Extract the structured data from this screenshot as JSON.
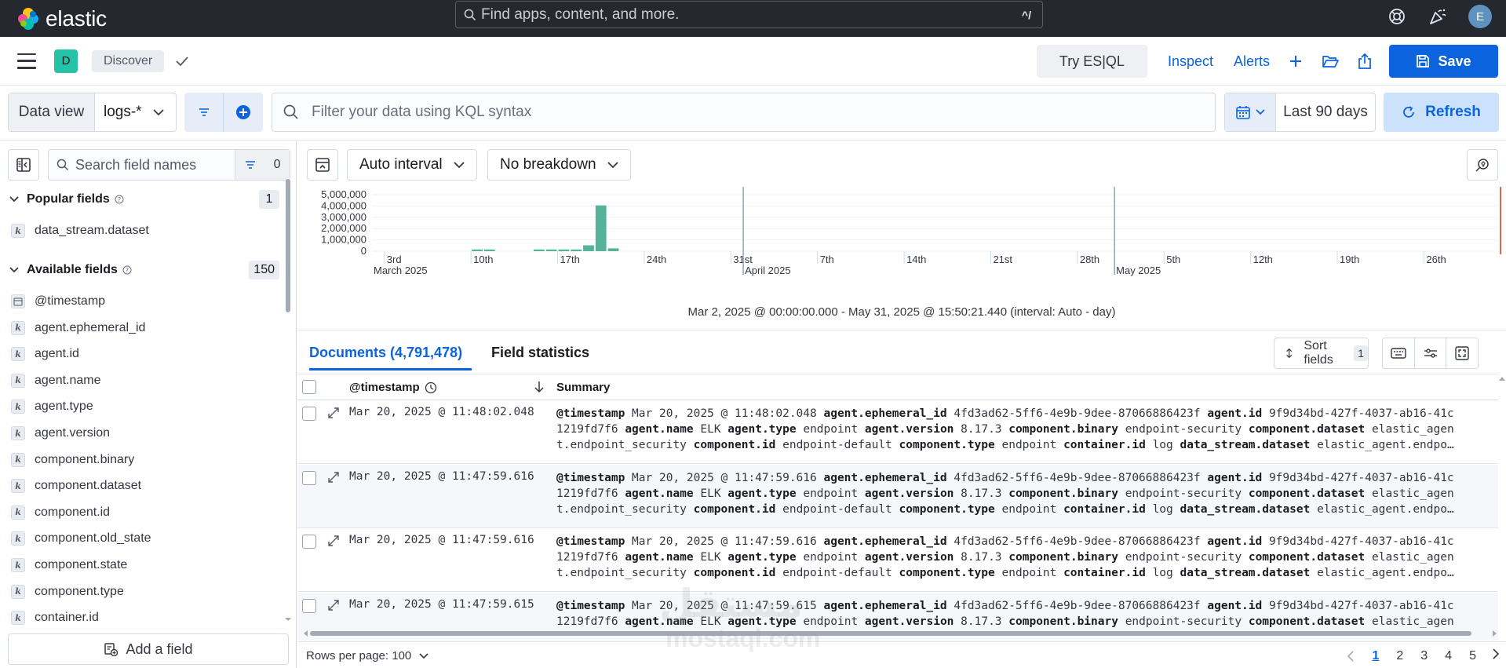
{
  "app": {
    "name": "elastic",
    "space_initial": "D",
    "user_initial": "E"
  },
  "search": {
    "placeholder": "Find apps, content, and more.",
    "shortcut": "^/"
  },
  "breadcrumb": {
    "current": "Discover"
  },
  "header": {
    "try_esql": "Try ES|QL",
    "inspect": "Inspect",
    "alerts": "Alerts",
    "save": "Save"
  },
  "query": {
    "data_view_label": "Data view",
    "data_view_value": "logs-*",
    "kql_placeholder": "Filter your data using KQL syntax",
    "date_range": "Last 90 days",
    "refresh": "Refresh"
  },
  "sidebar": {
    "search_placeholder": "Search field names",
    "filter_count": "0",
    "popular_title": "Popular fields",
    "popular_count": "1",
    "popular_fields": [
      {
        "name": "data_stream.dataset",
        "type": "k"
      }
    ],
    "available_title": "Available fields",
    "available_count": "150",
    "available_fields": [
      {
        "name": "@timestamp",
        "type": "date"
      },
      {
        "name": "agent.ephemeral_id",
        "type": "k"
      },
      {
        "name": "agent.id",
        "type": "k"
      },
      {
        "name": "agent.name",
        "type": "k"
      },
      {
        "name": "agent.type",
        "type": "k"
      },
      {
        "name": "agent.version",
        "type": "k"
      },
      {
        "name": "component.binary",
        "type": "k"
      },
      {
        "name": "component.dataset",
        "type": "k"
      },
      {
        "name": "component.id",
        "type": "k"
      },
      {
        "name": "component.old_state",
        "type": "k"
      },
      {
        "name": "component.state",
        "type": "k"
      },
      {
        "name": "component.type",
        "type": "k"
      },
      {
        "name": "container.id",
        "type": "k"
      }
    ],
    "add_field": "Add a field"
  },
  "toolbar": {
    "interval": "Auto interval",
    "breakdown": "No breakdown"
  },
  "chart_data": {
    "type": "bar",
    "y_ticks": [
      "5,000,000",
      "4,000,000",
      "3,000,000",
      "2,000,000",
      "1,000,000",
      "0"
    ],
    "ylim": [
      0,
      5000000
    ],
    "x_ticks": [
      "3rd",
      "10th",
      "17th",
      "24th",
      "31st",
      "7th",
      "14th",
      "21st",
      "28th",
      "5th",
      "12th",
      "19th",
      "26th"
    ],
    "month_labels": [
      "March 2025",
      "April 2025",
      "May 2025"
    ],
    "x_start": "2025-03-02",
    "x_end": "2025-05-31",
    "bars": [
      {
        "date": "2025-03-10",
        "value": 150000
      },
      {
        "date": "2025-03-11",
        "value": 150000
      },
      {
        "date": "2025-03-15",
        "value": 150000
      },
      {
        "date": "2025-03-16",
        "value": 150000
      },
      {
        "date": "2025-03-17",
        "value": 150000
      },
      {
        "date": "2025-03-18",
        "value": 150000
      },
      {
        "date": "2025-03-19",
        "value": 520000
      },
      {
        "date": "2025-03-20",
        "value": 4050000
      },
      {
        "date": "2025-03-21",
        "value": 250000
      }
    ],
    "color": "#54b399",
    "range_text": "Mar 2, 2025 @ 00:00:00.000 - May 31, 2025 @ 15:50:21.440 (interval: Auto - day)"
  },
  "tabs": {
    "documents": "Documents (4,791,478)",
    "field_statistics": "Field statistics"
  },
  "grid": {
    "sort_fields": "Sort fields",
    "sort_count": "1",
    "col_timestamp": "@timestamp",
    "col_summary": "Summary",
    "rows": [
      {
        "timestamp": "Mar 20, 2025 @ 11:48:02.048",
        "line1": [
          [
            "@timestamp",
            "Mar 20, 2025 @ 11:48:02.048"
          ],
          [
            "agent.ephemeral_id",
            "4fd3ad62-5ff6-4e9b-9dee-87066886423f"
          ],
          [
            "agent.id",
            "9f9d34bd-427f-4037-ab16-41c"
          ]
        ],
        "line2": [
          [
            "",
            "1219fd7f6"
          ],
          [
            "agent.name",
            "ELK"
          ],
          [
            "agent.type",
            "endpoint"
          ],
          [
            "agent.version",
            "8.17.3"
          ],
          [
            "component.binary",
            "endpoint-security"
          ],
          [
            "component.dataset",
            "elastic_agen"
          ]
        ],
        "line3": [
          [
            "",
            "t.endpoint_security"
          ],
          [
            "component.id",
            "endpoint-default"
          ],
          [
            "component.type",
            "endpoint"
          ],
          [
            "container.id",
            "log"
          ],
          [
            "data_stream.dataset",
            "elastic_agent.endpo…"
          ]
        ]
      },
      {
        "timestamp": "Mar 20, 2025 @ 11:47:59.616",
        "line1": [
          [
            "@timestamp",
            "Mar 20, 2025 @ 11:47:59.616"
          ],
          [
            "agent.ephemeral_id",
            "4fd3ad62-5ff6-4e9b-9dee-87066886423f"
          ],
          [
            "agent.id",
            "9f9d34bd-427f-4037-ab16-41c"
          ]
        ],
        "line2": [
          [
            "",
            "1219fd7f6"
          ],
          [
            "agent.name",
            "ELK"
          ],
          [
            "agent.type",
            "endpoint"
          ],
          [
            "agent.version",
            "8.17.3"
          ],
          [
            "component.binary",
            "endpoint-security"
          ],
          [
            "component.dataset",
            "elastic_agen"
          ]
        ],
        "line3": [
          [
            "",
            "t.endpoint_security"
          ],
          [
            "component.id",
            "endpoint-default"
          ],
          [
            "component.type",
            "endpoint"
          ],
          [
            "container.id",
            "log"
          ],
          [
            "data_stream.dataset",
            "elastic_agent.endpo…"
          ]
        ]
      },
      {
        "timestamp": "Mar 20, 2025 @ 11:47:59.616",
        "line1": [
          [
            "@timestamp",
            "Mar 20, 2025 @ 11:47:59.616"
          ],
          [
            "agent.ephemeral_id",
            "4fd3ad62-5ff6-4e9b-9dee-87066886423f"
          ],
          [
            "agent.id",
            "9f9d34bd-427f-4037-ab16-41c"
          ]
        ],
        "line2": [
          [
            "",
            "1219fd7f6"
          ],
          [
            "agent.name",
            "ELK"
          ],
          [
            "agent.type",
            "endpoint"
          ],
          [
            "agent.version",
            "8.17.3"
          ],
          [
            "component.binary",
            "endpoint-security"
          ],
          [
            "component.dataset",
            "elastic_agen"
          ]
        ],
        "line3": [
          [
            "",
            "t.endpoint_security"
          ],
          [
            "component.id",
            "endpoint-default"
          ],
          [
            "component.type",
            "endpoint"
          ],
          [
            "container.id",
            "log"
          ],
          [
            "data_stream.dataset",
            "elastic_agent.endpo…"
          ]
        ]
      },
      {
        "timestamp": "Mar 20, 2025 @ 11:47:59.615",
        "line1": [
          [
            "@timestamp",
            "Mar 20, 2025 @ 11:47:59.615"
          ],
          [
            "agent.ephemeral_id",
            "4fd3ad62-5ff6-4e9b-9dee-87066886423f"
          ],
          [
            "agent.id",
            "9f9d34bd-427f-4037-ab16-41c"
          ]
        ],
        "line2": [
          [
            "",
            "1219fd7f6"
          ],
          [
            "agent.name",
            "ELK"
          ],
          [
            "agent.type",
            "endpoint"
          ],
          [
            "agent.version",
            "8.17.3"
          ],
          [
            "component.binary",
            "endpoint-security"
          ],
          [
            "component.dataset",
            "elastic_agen"
          ]
        ],
        "line3": []
      }
    ]
  },
  "footer": {
    "rows_per_page": "Rows per page: 100",
    "pages": [
      "1",
      "2",
      "3",
      "4",
      "5"
    ],
    "current_page": "1"
  },
  "watermark": {
    "line1": "مستقل",
    "line2": "mostaql.com"
  },
  "colors": {
    "accent": "#0b64dd",
    "topbar": "#25282f",
    "bar": "#54b399",
    "space": "#24c2a7"
  }
}
